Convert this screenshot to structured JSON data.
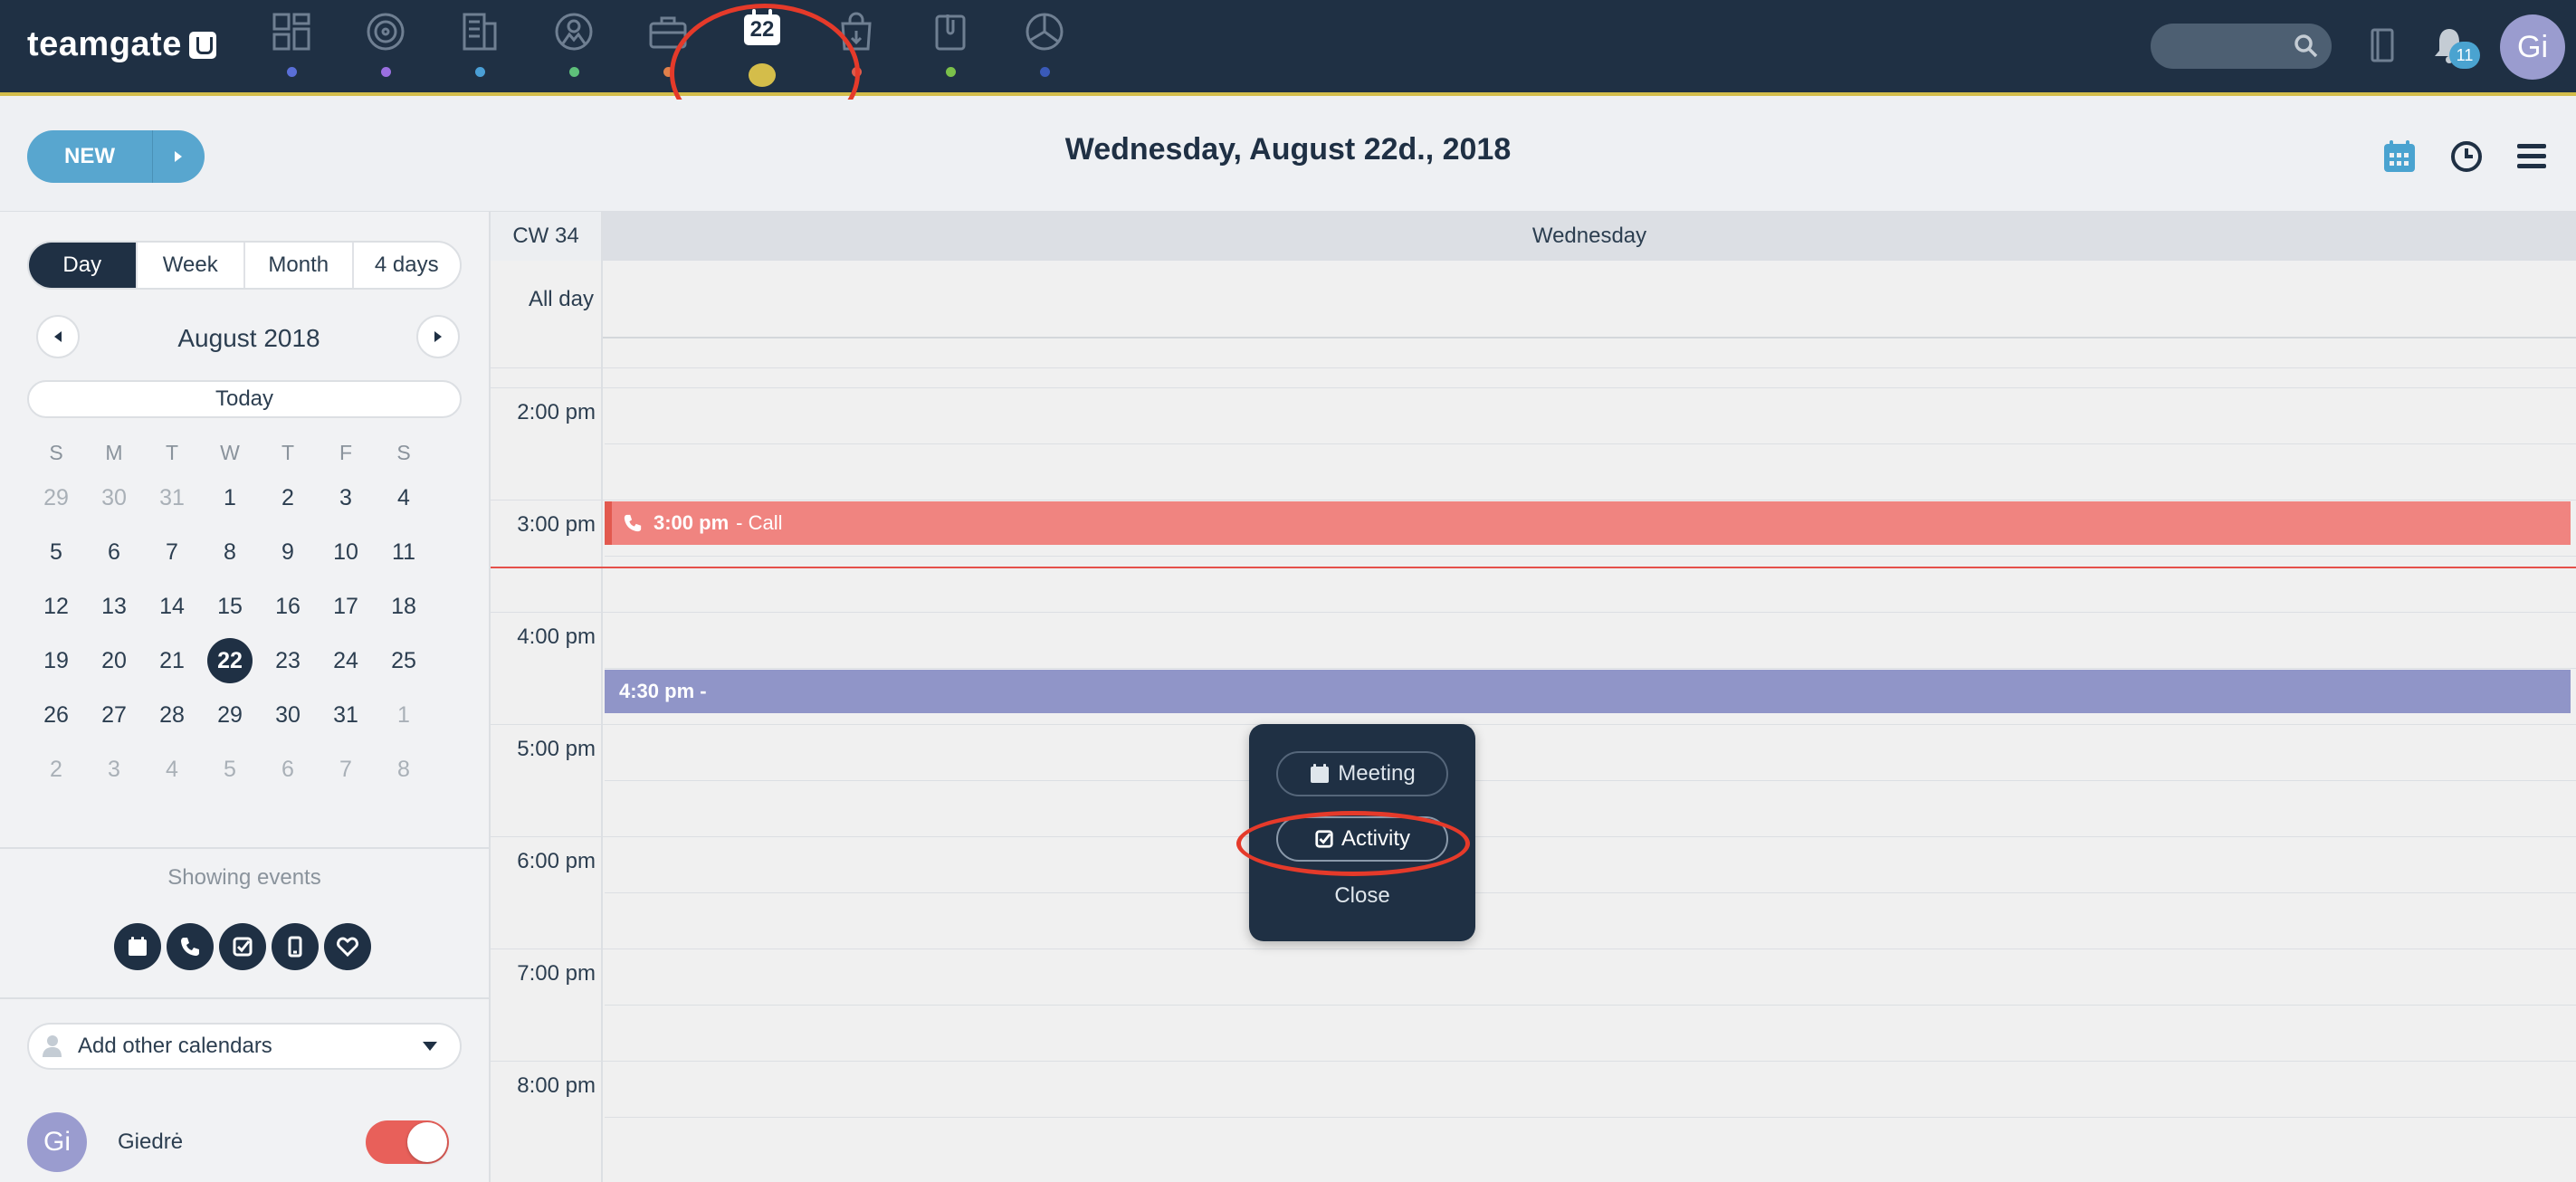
{
  "app": {
    "logo_text": "teamgate"
  },
  "nav": {
    "items": [
      {
        "icon": "dashboard-icon",
        "dot_color": "#5a6fd8"
      },
      {
        "icon": "target-icon",
        "dot_color": "#9a6fe0"
      },
      {
        "icon": "companies-icon",
        "dot_color": "#4a9fd6"
      },
      {
        "icon": "contacts-icon",
        "dot_color": "#5ec07a"
      },
      {
        "icon": "deals-icon",
        "dot_color": "#e0804a"
      },
      {
        "icon": "calendar-icon",
        "dot_color": "#d4bd4a",
        "badge": "22",
        "active": true
      },
      {
        "icon": "orders-icon",
        "dot_color": "#e05a4a"
      },
      {
        "icon": "files-icon",
        "dot_color": "#7bc04a"
      },
      {
        "icon": "reports-icon",
        "dot_color": "#3a5ab8"
      }
    ],
    "notification_count": "11",
    "user_initials": "Gi"
  },
  "header": {
    "new_label": "NEW",
    "title": "Wednesday, August 22d., 2018"
  },
  "sidebar": {
    "view_tabs": [
      {
        "label": "Day",
        "active": true
      },
      {
        "label": "Week",
        "active": false
      },
      {
        "label": "Month",
        "active": false
      },
      {
        "label": "4 days",
        "active": false
      }
    ],
    "month_label": "August 2018",
    "today_label": "Today",
    "weekday_headers": [
      "S",
      "M",
      "T",
      "W",
      "T",
      "F",
      "S"
    ],
    "weeks": [
      [
        {
          "d": "29",
          "m": true
        },
        {
          "d": "30",
          "m": true
        },
        {
          "d": "31",
          "m": true
        },
        {
          "d": "1"
        },
        {
          "d": "2"
        },
        {
          "d": "3"
        },
        {
          "d": "4"
        }
      ],
      [
        {
          "d": "5"
        },
        {
          "d": "6"
        },
        {
          "d": "7"
        },
        {
          "d": "8"
        },
        {
          "d": "9"
        },
        {
          "d": "10"
        },
        {
          "d": "11"
        }
      ],
      [
        {
          "d": "12"
        },
        {
          "d": "13"
        },
        {
          "d": "14"
        },
        {
          "d": "15"
        },
        {
          "d": "16"
        },
        {
          "d": "17"
        },
        {
          "d": "18"
        }
      ],
      [
        {
          "d": "19"
        },
        {
          "d": "20"
        },
        {
          "d": "21"
        },
        {
          "d": "22",
          "sel": true
        },
        {
          "d": "23"
        },
        {
          "d": "24"
        },
        {
          "d": "25"
        }
      ],
      [
        {
          "d": "26"
        },
        {
          "d": "27"
        },
        {
          "d": "28"
        },
        {
          "d": "29"
        },
        {
          "d": "30"
        },
        {
          "d": "31"
        },
        {
          "d": "1",
          "m": true
        }
      ],
      [
        {
          "d": "2",
          "m": true
        },
        {
          "d": "3",
          "m": true
        },
        {
          "d": "4",
          "m": true
        },
        {
          "d": "5",
          "m": true
        },
        {
          "d": "6",
          "m": true
        },
        {
          "d": "7",
          "m": true
        },
        {
          "d": "8",
          "m": true
        }
      ]
    ],
    "showing_events_label": "Showing events",
    "event_filters": [
      "calendar-icon",
      "phone-icon",
      "checkbox-icon",
      "mobile-icon",
      "heart-icon"
    ],
    "add_calendars_label": "Add other calendars",
    "user": {
      "initials": "Gi",
      "name": "Giedrė",
      "enabled": true
    }
  },
  "calendar": {
    "week_label": "CW 34",
    "day_label": "Wednesday",
    "all_day_label": "All day",
    "hours": [
      "2:00 pm",
      "3:00 pm",
      "4:00 pm",
      "5:00 pm",
      "6:00 pm",
      "7:00 pm",
      "8:00 pm"
    ],
    "events": [
      {
        "time": "3:00 pm",
        "title": "- Call",
        "type": "call",
        "color": "#f08480"
      },
      {
        "time": "4:30 pm -",
        "title": "",
        "type": "task",
        "color": "#9095c8"
      }
    ]
  },
  "popup": {
    "meeting_label": "Meeting",
    "activity_label": "Activity",
    "close_label": "Close"
  },
  "colors": {
    "nav_bg": "#1f3044",
    "accent_blue": "#58a6cf",
    "highlight_red": "#e53a2a"
  }
}
